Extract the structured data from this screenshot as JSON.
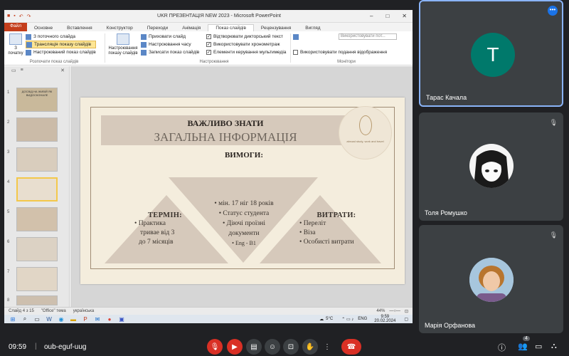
{
  "meeting": {
    "time": "09:59",
    "separator": "|",
    "code": "oub-eguf-uug",
    "participants_count": "4"
  },
  "ppt": {
    "window_title": "UKR ПРЕЗЕНТАЦІЯ NEW 2023 - Microsoft PowerPoint",
    "tabs": [
      "Файл",
      "Основне",
      "Вставлення",
      "Конструктор",
      "Переходи",
      "Анімація",
      "Показ слайдів",
      "Рецензування",
      "Вигляд"
    ],
    "ribbon": {
      "from_start": "З початку",
      "from_current": "З поточного слайда",
      "broadcast": "Трансляція показу слайдів",
      "custom": "Настроюваний показ слайдів",
      "group1": "Розпочати показ слайдів",
      "setup": "Настроювання показу слайдів",
      "hide": "Приховати слайд",
      "timing": "Настроювання часу",
      "record": "Записати показ слайдів",
      "narr": "Відтворювати дикторський текст",
      "use_timings": "Використовувати хронометраж",
      "media": "Елементи керування мультимедіа",
      "group2": "Настроювання",
      "monitor": "Використовувати пот...",
      "presenter": "Використовувати подання відображення",
      "group3": "Монітори"
    },
    "slide": {
      "title1": "ВАЖЛИВО ЗНАТИ",
      "title2": "ЗАГАЛЬНА ІНФОРМАЦІЯ",
      "req": "ВИМОГИ:",
      "left_head": "ТЕРМІН:",
      "left_items": [
        "• Практика",
        "тривае від 3",
        "до 7 місяців"
      ],
      "mid_items": [
        "• мін. 17 ніг 18 років",
        "• Статус студента",
        "• Діючі проїзні",
        "документи",
        "• Eng - B1"
      ],
      "right_head": "ВИТРАТИ:",
      "right_items": [
        "• Переліт",
        "• Віза",
        "• Особисті витрати"
      ],
      "logo_text": "abroad study, work and travel"
    },
    "thumb1": "ДОСВІД НА ЖИВІЙ ЯК ВИДОСКОНАЛЕ",
    "status": {
      "slide": "Слайд 4 з 15",
      "theme": "\"Office\" тема",
      "lang": "українська",
      "zoom": "44%"
    },
    "taskbar": {
      "temp": "5°C",
      "lang": "ENG",
      "time": "9:59",
      "date": "20.02.2024"
    }
  },
  "tiles": [
    {
      "name": "Тарас Качала",
      "initial": "T",
      "color": "#00796b"
    },
    {
      "name": "Толя Ромушко"
    },
    {
      "name": "Марія Орфанова"
    }
  ],
  "colors": {
    "end_call": "#d93025",
    "active_border": "#8ab4f8"
  }
}
